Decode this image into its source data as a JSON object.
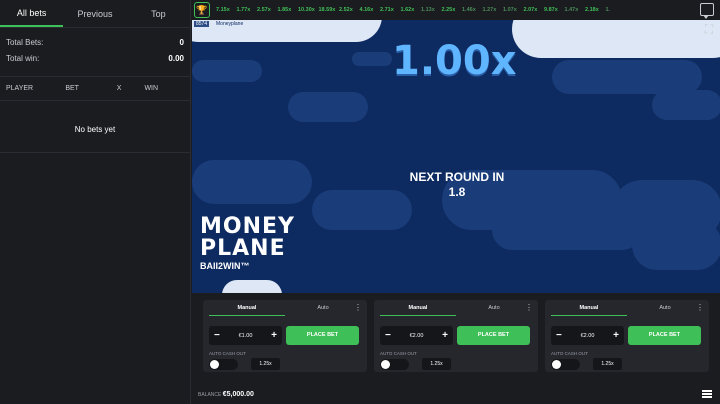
{
  "left_panel": {
    "tabs": [
      {
        "label": "All bets"
      },
      {
        "label": "Previous"
      },
      {
        "label": "Top"
      }
    ],
    "stats": {
      "total_bets_label": "Total Bets:",
      "total_bets_value": "0",
      "total_win_label": "Total win:",
      "total_win_value": "0.00"
    },
    "columns": {
      "player": "PLAYER",
      "bet": "BET",
      "x": "X",
      "win": "WIN"
    },
    "empty_text": "No bets yet"
  },
  "history": {
    "items": [
      {
        "value": "7.15x",
        "color": "#3fbf57"
      },
      {
        "value": "1.77x",
        "color": "#3fbf57"
      },
      {
        "value": "2.57x",
        "color": "#3fbf57"
      },
      {
        "value": "1.85x",
        "color": "#3fbf57"
      },
      {
        "value": "10.30x",
        "color": "#3fbf57"
      },
      {
        "value": "18.59x",
        "color": "#3fbf57"
      },
      {
        "value": "2.52x",
        "color": "#3fbf57"
      },
      {
        "value": "4.16x",
        "color": "#3fbf57"
      },
      {
        "value": "2.71x",
        "color": "#3fbf57"
      },
      {
        "value": "1.62x",
        "color": "#3fbf57"
      },
      {
        "value": "1.13x",
        "color": "#4a8c5a"
      },
      {
        "value": "2.25x",
        "color": "#3fbf57"
      },
      {
        "value": "1.46x",
        "color": "#4a8c5a"
      },
      {
        "value": "1.27x",
        "color": "#4a8c5a"
      },
      {
        "value": "1.07x",
        "color": "#4a8c5a"
      },
      {
        "value": "2.07x",
        "color": "#3fbf57"
      },
      {
        "value": "9.87x",
        "color": "#3fbf57"
      },
      {
        "value": "1.47x",
        "color": "#4a8c5a"
      },
      {
        "value": "2.18x",
        "color": "#3fbf57"
      },
      {
        "value": "1.",
        "color": "#4a8c5a"
      }
    ]
  },
  "game": {
    "round_id": "8574",
    "game_name": "Moneyplane",
    "multiplier": "1.00x",
    "next_round_line1": "NEXT ROUND IN",
    "next_round_line2": "1.8",
    "logo_line1": "MONEY",
    "logo_line2": "PLANE",
    "logo_line3": "BAII2WIN™"
  },
  "bet_panels": [
    {
      "tab_manual": "Manual",
      "tab_auto": "Auto",
      "amount": "€1.00",
      "place_label": "PLACE BET",
      "auto_cash_out_label": "AUTO CASH OUT",
      "cash_out_value": "1.25x"
    },
    {
      "tab_manual": "Manual",
      "tab_auto": "Auto",
      "amount": "€2.00",
      "place_label": "PLACE BET",
      "auto_cash_out_label": "AUTO CASH OUT",
      "cash_out_value": "1.25x"
    },
    {
      "tab_manual": "Manual",
      "tab_auto": "Auto",
      "amount": "€2.00",
      "place_label": "PLACE BET",
      "auto_cash_out_label": "AUTO CASH OUT",
      "cash_out_value": "1.25x"
    }
  ],
  "balance": {
    "label": "BALANCE",
    "value": "€5,000.00"
  },
  "colors": {
    "accent": "#3fbf57",
    "sky": "#0e2b61",
    "multiplier": "#5fb6ff"
  }
}
